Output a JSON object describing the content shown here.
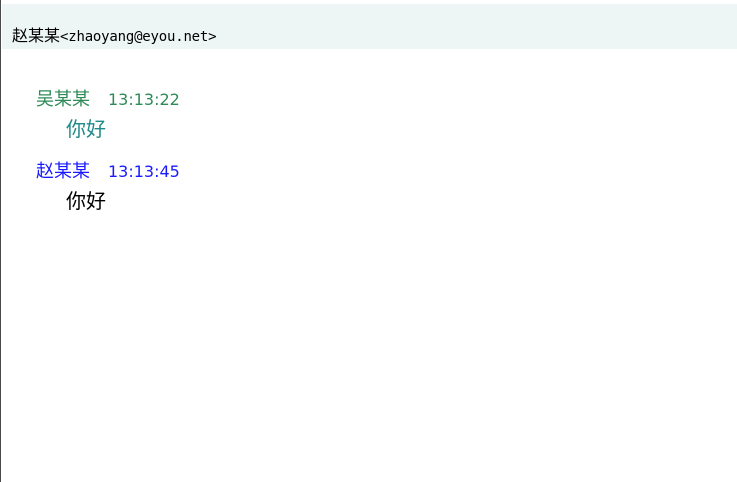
{
  "header": {
    "contact_name": "赵某某",
    "contact_email": "<zhaoyang@eyou.net>"
  },
  "messages": [
    {
      "sender": "吴某某",
      "time": "13:13:22",
      "text": "你好",
      "header_color": "#2e8b57",
      "text_color": "#1f8a8a"
    },
    {
      "sender": "赵某某",
      "time": "13:13:45",
      "text": "你好",
      "header_color": "#1a1aff",
      "text_color": "#000000"
    }
  ]
}
